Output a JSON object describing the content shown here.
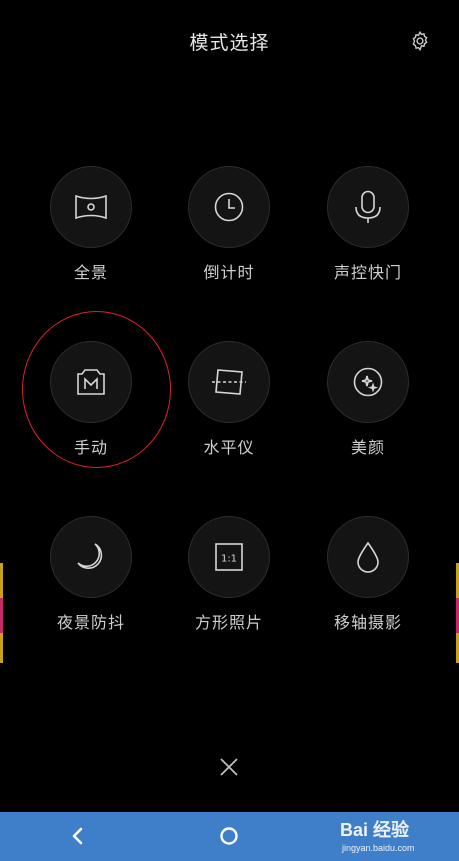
{
  "header": {
    "title": "模式选择",
    "settings_icon": "gear-icon"
  },
  "modes": [
    {
      "label": "全景",
      "icon": "panorama-icon"
    },
    {
      "label": "倒计时",
      "icon": "timer-clock-icon"
    },
    {
      "label": "声控快门",
      "icon": "microphone-icon"
    },
    {
      "label": "手动",
      "icon": "manual-m-icon",
      "highlighted": true
    },
    {
      "label": "水平仪",
      "icon": "level-icon"
    },
    {
      "label": "美颜",
      "icon": "beauty-sparkle-icon"
    },
    {
      "label": "夜景防抖",
      "icon": "moon-icon"
    },
    {
      "label": "方形照片",
      "icon": "square-1-1-icon"
    },
    {
      "label": "移轴摄影",
      "icon": "tilt-shift-drop-icon"
    }
  ],
  "close_icon": "close-icon",
  "navbar": {
    "back_icon": "back-chevron-icon",
    "home_icon": "home-circle-icon",
    "color": "#3f7fc9"
  },
  "watermark": {
    "logo": "Bai 经验",
    "url": "jingyan.baidu.com"
  },
  "colors": {
    "background": "#000000",
    "circle": "#141414",
    "highlight": "#d8232a",
    "text": "#cfcfcf"
  }
}
